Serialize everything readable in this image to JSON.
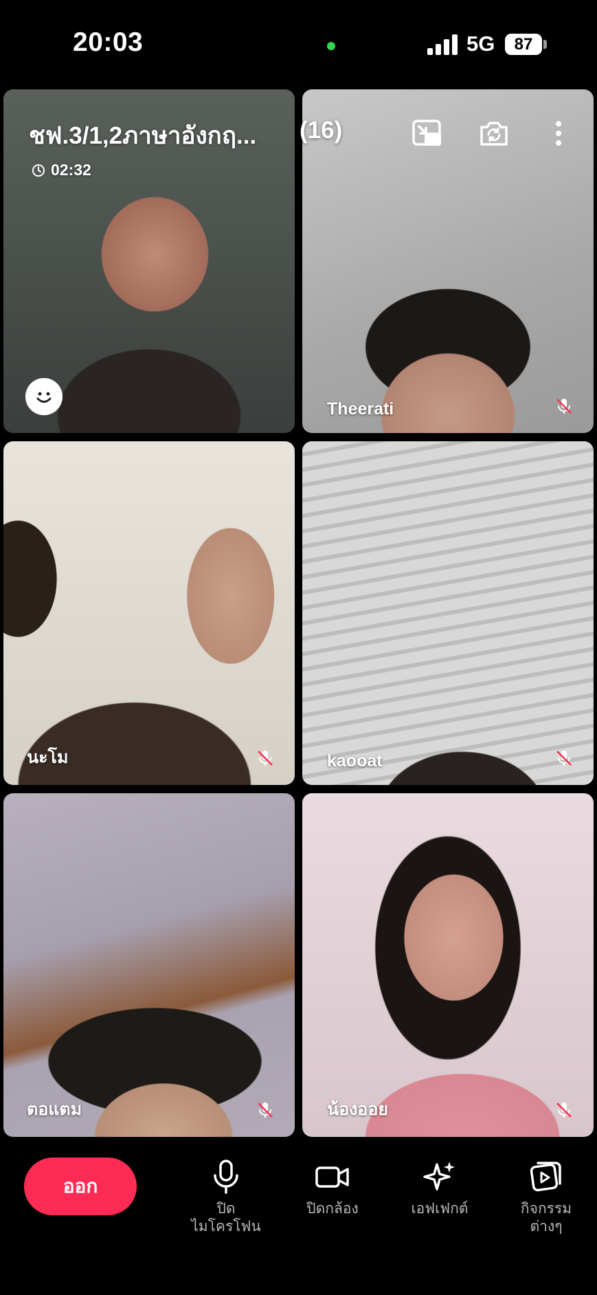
{
  "status_bar": {
    "time": "20:03",
    "network": "5G",
    "battery": "87"
  },
  "call": {
    "title": "ชฟ.3/1,2ภาษาอังกฤ...",
    "participant_count": "(16)",
    "elapsed": "02:32"
  },
  "participants": [
    {
      "name": "",
      "muted": false
    },
    {
      "name": "Theerati",
      "muted": true
    },
    {
      "name": "นะโม",
      "muted": true
    },
    {
      "name": "kaooat",
      "muted": true
    },
    {
      "name": "ตอแตม",
      "muted": true
    },
    {
      "name": "น้องออย",
      "muted": true
    }
  ],
  "controls": {
    "leave": "ออก",
    "mic_line1": "ปิด",
    "mic_line2": "ไมโครโฟน",
    "camera": "ปิดกล้อง",
    "effects": "เอฟเฟกต์",
    "activities_line1": "กิจกรรม",
    "activities_line2": "ต่างๆ"
  },
  "colors": {
    "leave_button": "#fe2c55",
    "muted_icon_accent": "#fe2c55",
    "camera_indicator": "#36d34d"
  },
  "icons": [
    "signal-icon",
    "battery-icon",
    "clock-icon",
    "minimize-icon",
    "flip-camera-icon",
    "more-icon",
    "emoji-icon",
    "mic-off-icon",
    "microphone-icon",
    "camera-icon",
    "sparkle-icon",
    "activities-icon"
  ]
}
